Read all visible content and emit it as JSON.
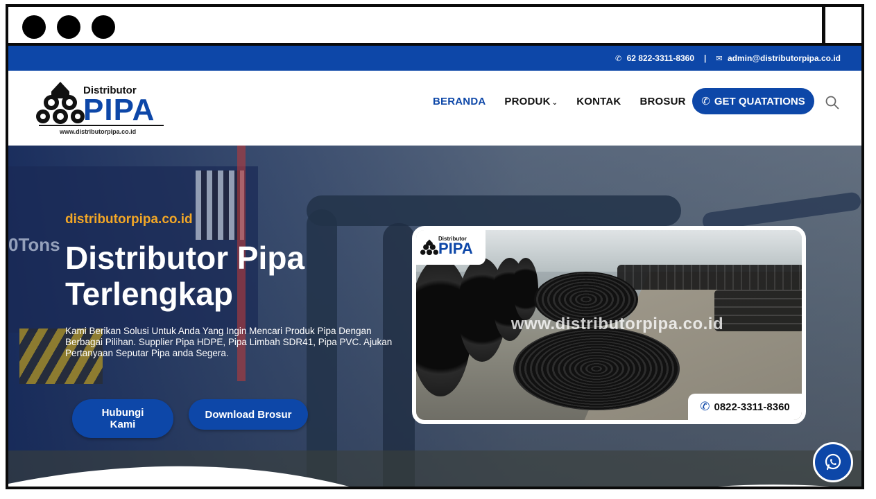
{
  "topbar": {
    "phone": "62 822-3311-8360",
    "separator": "|",
    "email": "admin@distributorpipa.co.id"
  },
  "logo": {
    "word_top": "Distributor",
    "word_main": "PIPA",
    "url": "www.distributorpipa.co.id"
  },
  "nav": {
    "items": [
      {
        "label": "BERANDA",
        "active": true
      },
      {
        "label": "PRODUK",
        "has_dropdown": true
      },
      {
        "label": "KONTAK"
      },
      {
        "label": "BROSUR"
      }
    ],
    "cta_label": "GET QUATATIONS"
  },
  "hero": {
    "kicker": "distributorpipa.co.id",
    "title": "Distributor Pipa Terlengkap",
    "description": "Kami Berikan Solusi Untuk Anda Yang Ingin Mencari Produk Pipa Dengan Berbagai Pilihan. Supplier Pipa HDPE, Pipa Limbah SDR41, Pipa PVC. Ajukan Pertanyaan Seputar Pipa anda Segera.",
    "bg_text": "0Tons",
    "btn_contact": "Hubungi Kami",
    "btn_brosur": "Download Brosur"
  },
  "card": {
    "logo_top": "Distributor",
    "logo_main": "PIPA",
    "watermark": "www.distributorpipa.co.id",
    "phone": "0822-3311-8360"
  },
  "colors": {
    "brand_blue": "#0d47a8",
    "accent_orange": "#f3a726"
  },
  "icons": [
    "phone-icon",
    "mail-icon",
    "search-icon",
    "chevron-down-icon",
    "whatsapp-icon"
  ]
}
